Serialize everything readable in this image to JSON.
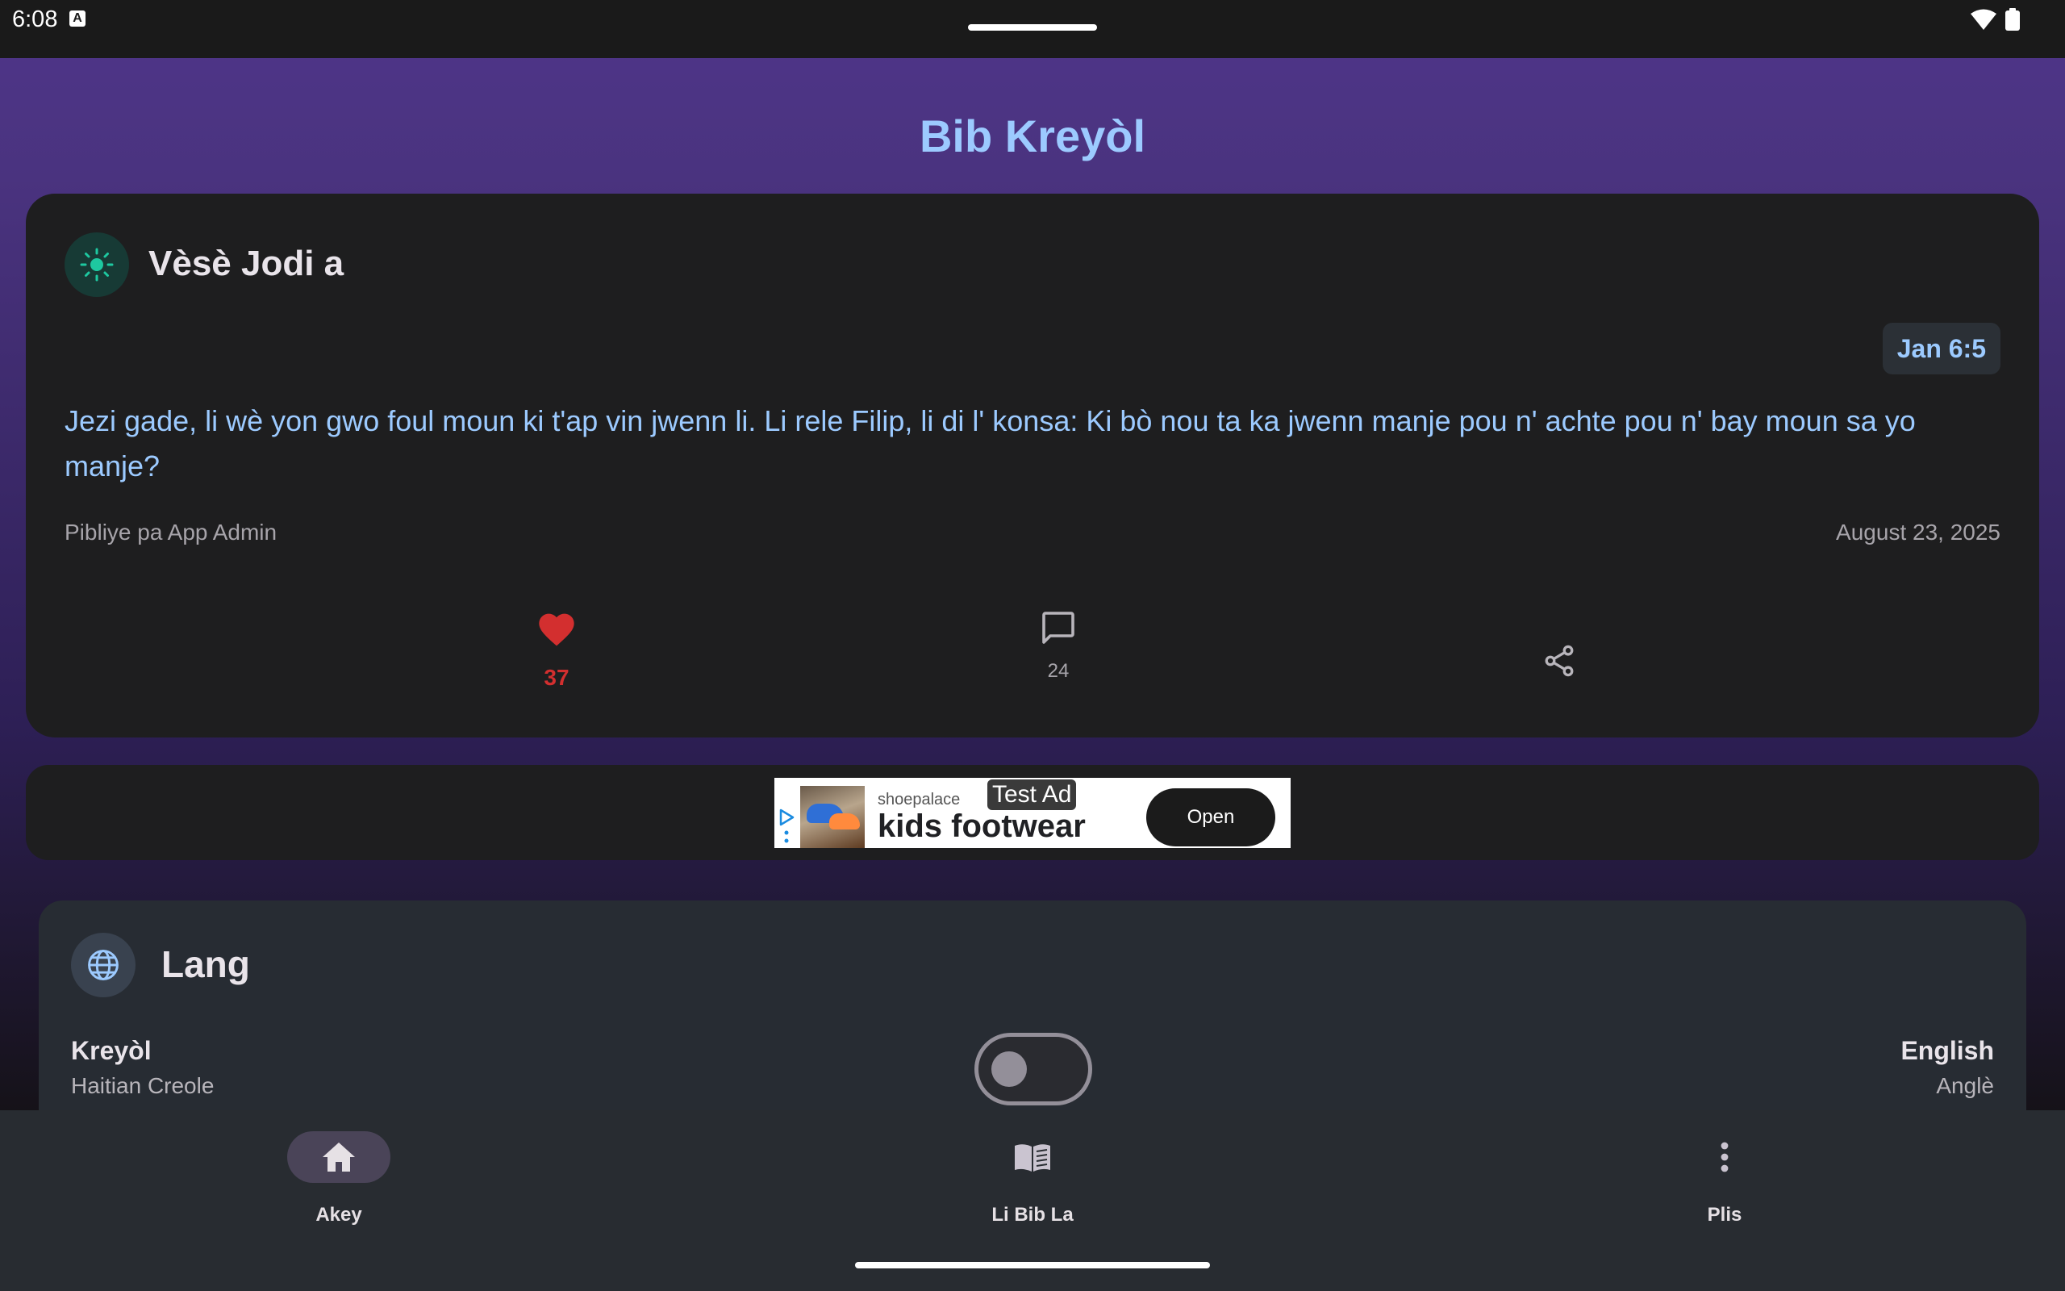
{
  "status_bar": {
    "time": "6:08",
    "notification_icon": "a-icon"
  },
  "app": {
    "title": "Bib Kreyòl"
  },
  "verse_of_day": {
    "title": "Vèsè Jodi a",
    "icon": "sun-icon",
    "reference": "Jan 6:5",
    "text": "Jezi gade, li wè yon gwo foul moun ki t'ap vin jwenn li. Li rele Filip, li di l' konsa: Ki bò nou ta ka jwenn manje pou n' achte pou n' bay moun sa yo manje?",
    "author": "Pibliye pa App Admin",
    "date": "August 23, 2025",
    "likes": "37",
    "comments": "24"
  },
  "ad": {
    "advertiser": "shoepalace",
    "headline": "kids footwear",
    "label": "Test Ad",
    "cta": "Open"
  },
  "language": {
    "title": "Lang",
    "left": {
      "name": "Kreyòl",
      "sub": "Haitian Creole"
    },
    "right": {
      "name": "English",
      "sub": "Anglè"
    },
    "toggle_on": false
  },
  "bottom_nav": {
    "items": [
      {
        "label": "Akey",
        "icon": "home-icon",
        "selected": true
      },
      {
        "label": "Li Bib La",
        "icon": "book-icon",
        "selected": false
      },
      {
        "label": "Plis",
        "icon": "more-vert-icon",
        "selected": false
      }
    ]
  },
  "colors": {
    "accent": "#9ccaff",
    "like": "#d32f2f",
    "sun": "#1ec8a0",
    "card": "#1e1e1f",
    "nav": "#282c31"
  }
}
